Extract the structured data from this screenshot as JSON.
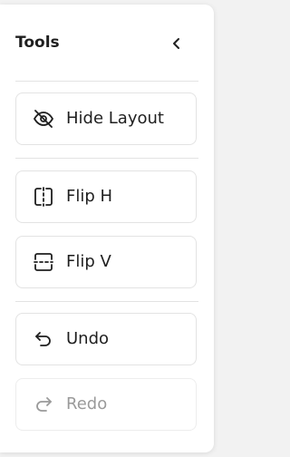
{
  "panel": {
    "title": "Tools"
  },
  "tools": {
    "hide_layout": {
      "label": "Hide Layout",
      "icon": "eye-off-icon"
    },
    "flip_h": {
      "label": "Flip H",
      "icon": "flip-horizontal-icon"
    },
    "flip_v": {
      "label": "Flip V",
      "icon": "flip-vertical-icon"
    },
    "undo": {
      "label": "Undo",
      "icon": "undo-icon"
    },
    "redo": {
      "label": "Redo",
      "icon": "redo-icon",
      "disabled": true
    }
  },
  "colors": {
    "text": "#1f1f1f",
    "disabled_text": "#9a9a9a",
    "border": "#e3e3e3",
    "background": "#f2f2f2",
    "panel": "#ffffff"
  }
}
